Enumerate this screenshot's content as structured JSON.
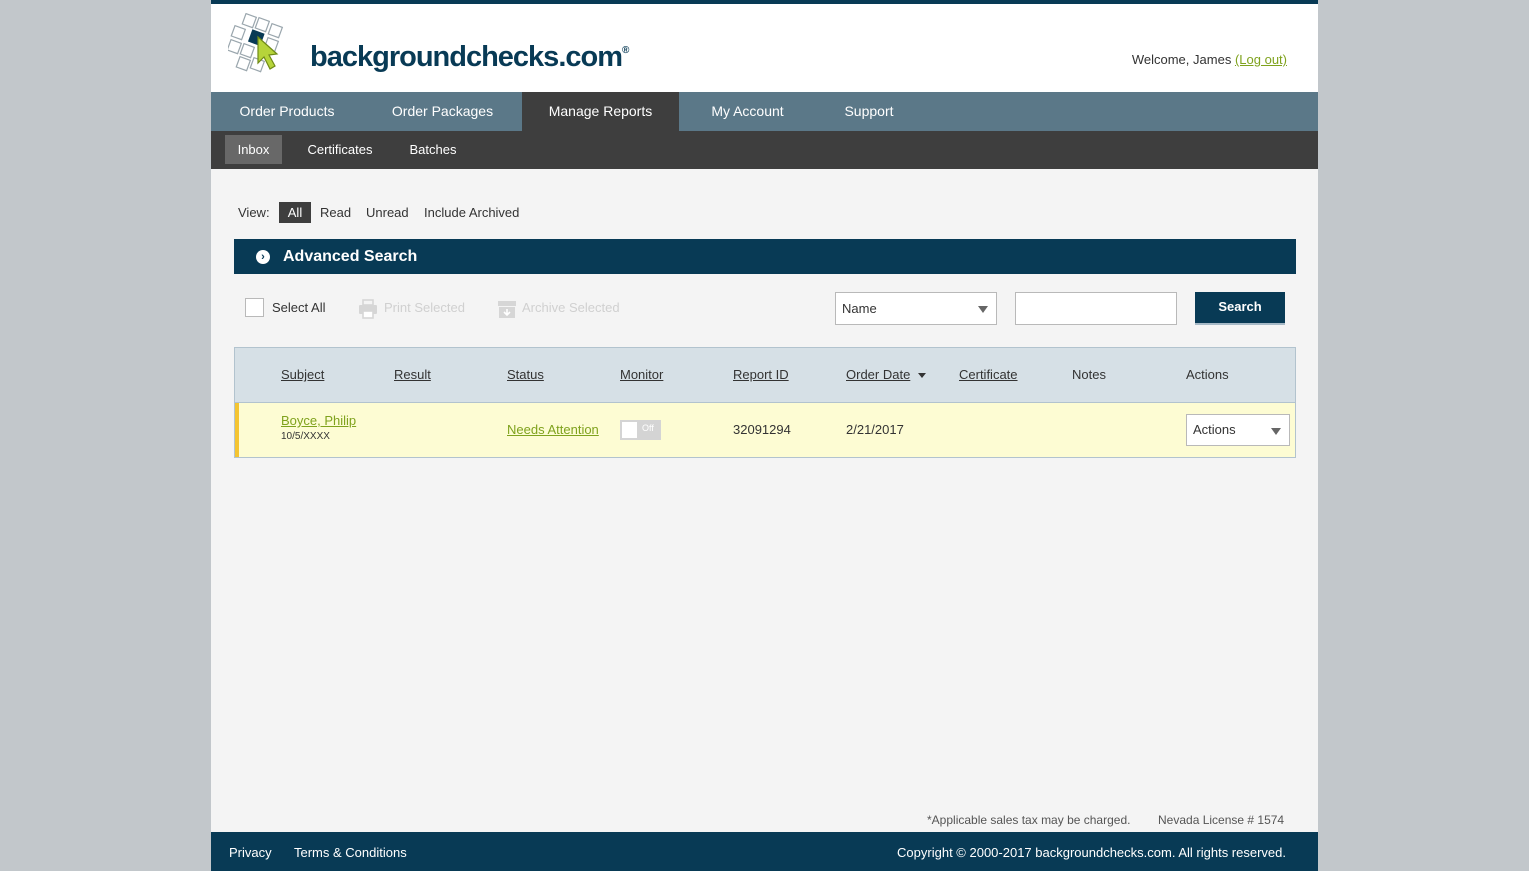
{
  "header": {
    "logo_text": "backgroundchecks.com",
    "logo_mark": "®",
    "welcome_prefix": "Welcome,",
    "user_name": "James",
    "logout_label": "(Log out)"
  },
  "main_nav": {
    "items": [
      {
        "label": "Order Products"
      },
      {
        "label": "Order Packages"
      },
      {
        "label": "Manage Reports",
        "active": true
      },
      {
        "label": "My Account"
      },
      {
        "label": "Support"
      }
    ]
  },
  "sub_nav": {
    "items": [
      {
        "label": "Inbox",
        "active": true
      },
      {
        "label": "Certificates"
      },
      {
        "label": "Batches"
      }
    ]
  },
  "view": {
    "label": "View:",
    "options": [
      {
        "label": "All",
        "active": true
      },
      {
        "label": "Read"
      },
      {
        "label": "Unread"
      },
      {
        "label": "Include Archived"
      }
    ]
  },
  "advanced_search": {
    "label": "Advanced Search"
  },
  "toolbar": {
    "select_all_label": "Select All",
    "print_selected_label": "Print Selected",
    "archive_selected_label": "Archive Selected",
    "search_field_selected": "Name",
    "search_input_value": "",
    "search_button_label": "Search"
  },
  "table": {
    "columns": [
      "Subject",
      "Result",
      "Status",
      "Monitor",
      "Report ID",
      "Order Date",
      "Certificate",
      "Notes",
      "Actions"
    ],
    "rows": [
      {
        "subject": "Boyce, Philip",
        "dob": "10/5/XXXX",
        "result": "",
        "status": "Needs Attention",
        "monitor": "Off",
        "report_id": "32091294",
        "order_date": "2/21/2017",
        "certificate": "",
        "notes": "",
        "actions": "Actions"
      }
    ]
  },
  "notes": {
    "tax_note": "*Applicable sales tax may be charged.",
    "license": "Nevada License # 1574"
  },
  "footer": {
    "privacy": "Privacy",
    "terms": "Terms & Conditions",
    "copyright": "Copyright © 2000-2017 backgroundchecks.com. All rights reserved."
  },
  "colors": {
    "brand_navy": "#083a55",
    "nav_slate": "#5b7888",
    "subnav_dark": "#3e3e3e",
    "link_green": "#7fa21d",
    "row_highlight": "#fdfcd3",
    "attention_flag": "#f4c430"
  },
  "icons": {
    "logo": "checkbox-grid-cursor-logo",
    "print": "printer-icon",
    "archive": "archive-box-icon",
    "advanced_search": "chevron-right-circle-icon",
    "sort": "caret-down-icon",
    "dropdown": "triangle-down-icon"
  }
}
